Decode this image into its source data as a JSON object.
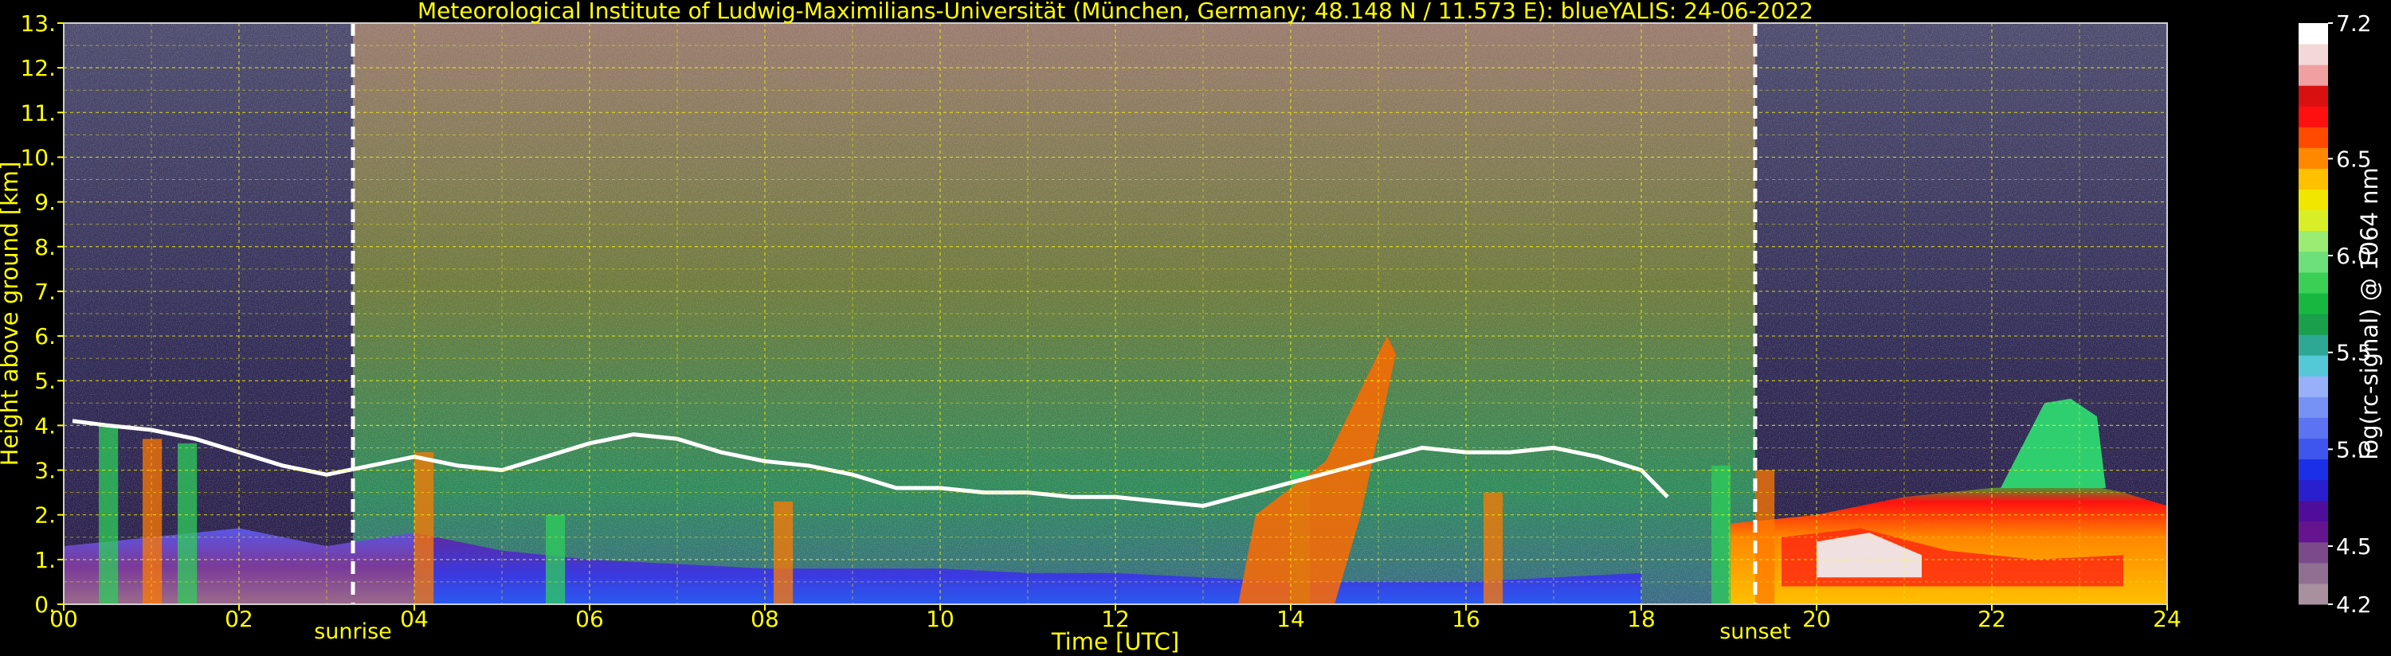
{
  "chart_data": {
    "type": "heatmap",
    "title": "Meteorological Institute of Ludwig-Maximilians-Universität (München, Germany; 48.148 N / 11.573 E):    blueYALIS: 24-06-2022",
    "xlabel": "Time [UTC]",
    "ylabel": "Height above ground [km]",
    "xlim": [
      0,
      24
    ],
    "ylim": [
      0,
      13
    ],
    "x_ticks": [
      "00",
      "02",
      "04",
      "06",
      "08",
      "10",
      "12",
      "14",
      "16",
      "18",
      "20",
      "22",
      "24"
    ],
    "y_ticks": [
      "0.",
      "1.",
      "2.",
      "3.",
      "4.",
      "5.",
      "6.",
      "7.",
      "8.",
      "9.",
      "10.",
      "11.",
      "12.",
      "13."
    ],
    "grid": true,
    "colorbar": {
      "label": "log(rc-signal) @ 1064 nm",
      "range": [
        4.2,
        7.2
      ],
      "ticks": [
        "4.2",
        "4.5",
        "5.0",
        "5.5",
        "6.0",
        "6.5",
        "7.2"
      ],
      "colors": [
        "#a8909f",
        "#8f6f92",
        "#7a4a8a",
        "#65148f",
        "#4f0e9a",
        "#2a1fcf",
        "#1c2fe8",
        "#3f56ee",
        "#5a74f2",
        "#7792f5",
        "#98b0f7",
        "#55c8d8",
        "#2ea895",
        "#1a9f4a",
        "#18b840",
        "#3ccf56",
        "#6ee07a",
        "#9aec72",
        "#d8ef28",
        "#f0e600",
        "#ffc000",
        "#ff8800",
        "#ff4a00",
        "#ff1010",
        "#d81010",
        "#f0a0a0",
        "#f3d8d8",
        "#ffffff"
      ]
    },
    "annotations": [
      {
        "text": "sunrise",
        "x": 3.3
      },
      {
        "text": "sunset",
        "x": 19.3
      }
    ],
    "features": {
      "cloud_base_km": [
        [
          0.1,
          4.1
        ],
        [
          0.5,
          4.0
        ],
        [
          1.0,
          3.9
        ],
        [
          1.5,
          3.7
        ],
        [
          2.0,
          3.4
        ],
        [
          2.5,
          3.1
        ],
        [
          3.0,
          2.9
        ],
        [
          3.5,
          3.1
        ],
        [
          4.0,
          3.3
        ],
        [
          4.5,
          3.1
        ],
        [
          5.0,
          3.0
        ],
        [
          5.5,
          3.3
        ],
        [
          6.0,
          3.6
        ],
        [
          6.5,
          3.8
        ],
        [
          7.0,
          3.7
        ],
        [
          7.5,
          3.4
        ],
        [
          8.0,
          3.2
        ],
        [
          8.5,
          3.1
        ],
        [
          9.0,
          2.9
        ],
        [
          9.5,
          2.6
        ],
        [
          10.0,
          2.6
        ],
        [
          10.5,
          2.5
        ],
        [
          11.0,
          2.5
        ],
        [
          11.5,
          2.4
        ],
        [
          12.0,
          2.4
        ],
        [
          12.5,
          2.3
        ],
        [
          13.0,
          2.2
        ],
        [
          15.5,
          3.5
        ],
        [
          16.0,
          3.4
        ],
        [
          16.5,
          3.4
        ],
        [
          17.0,
          3.5
        ],
        [
          17.5,
          3.3
        ],
        [
          18.0,
          3.0
        ],
        [
          18.3,
          2.4
        ]
      ],
      "boundary_layer_top_km": [
        [
          0,
          1.3
        ],
        [
          1,
          1.5
        ],
        [
          2,
          1.7
        ],
        [
          3,
          1.3
        ],
        [
          4,
          1.6
        ],
        [
          5,
          1.2
        ],
        [
          6,
          1.0
        ],
        [
          7,
          0.9
        ],
        [
          8,
          0.8
        ],
        [
          9,
          0.8
        ],
        [
          10,
          0.8
        ],
        [
          11,
          0.7
        ],
        [
          12,
          0.7
        ],
        [
          13,
          0.6
        ],
        [
          14,
          0.5
        ],
        [
          15,
          0.5
        ],
        [
          16,
          0.5
        ],
        [
          17,
          0.6
        ],
        [
          18,
          0.7
        ],
        [
          19,
          1.8
        ],
        [
          20,
          2.0
        ],
        [
          21,
          2.4
        ],
        [
          22,
          2.6
        ],
        [
          23,
          2.7
        ],
        [
          23.5,
          2.5
        ],
        [
          24,
          2.2
        ]
      ],
      "plume_tops_km": [
        [
          22.6,
          4.5
        ],
        [
          22.9,
          4.6
        ],
        [
          23.2,
          4.2
        ]
      ]
    }
  }
}
